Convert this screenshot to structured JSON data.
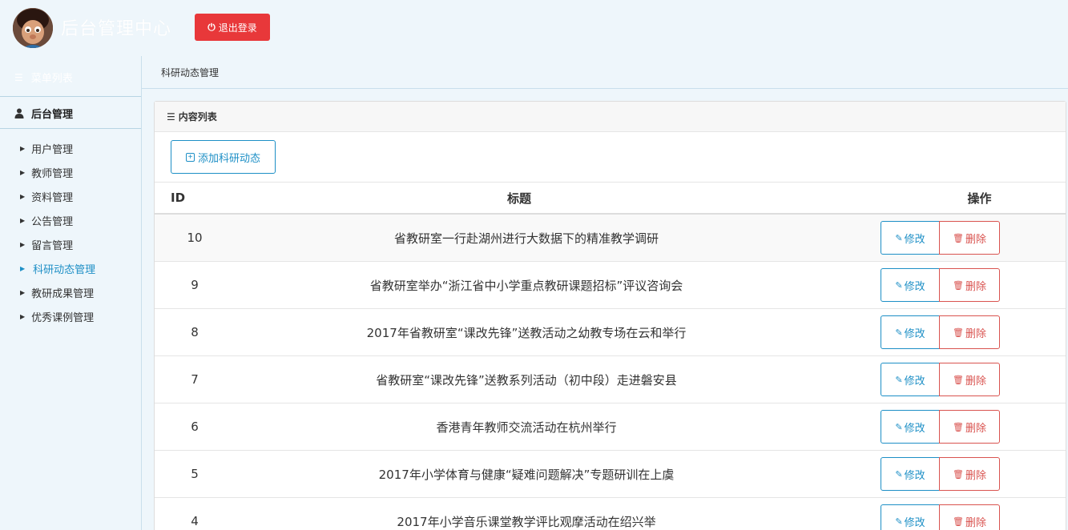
{
  "header": {
    "site_title": "后台管理中心",
    "logout_label": "退出登录"
  },
  "sidebar": {
    "menu_list_title": "菜单列表",
    "group_title": "后台管理",
    "items": [
      {
        "label": "用户管理",
        "active": false
      },
      {
        "label": "教师管理",
        "active": false
      },
      {
        "label": "资料管理",
        "active": false
      },
      {
        "label": "公告管理",
        "active": false
      },
      {
        "label": "留言管理",
        "active": false
      },
      {
        "label": "科研动态管理",
        "active": true
      },
      {
        "label": "教研成果管理",
        "active": false
      },
      {
        "label": "优秀课例管理",
        "active": false
      }
    ]
  },
  "breadcrumb": "科研动态管理",
  "panel": {
    "heading": "内容列表",
    "add_label": "添加科研动态"
  },
  "table": {
    "headers": {
      "id": "ID",
      "title": "标题",
      "ops": "操作"
    },
    "edit_label": "修改",
    "delete_label": "删除",
    "rows": [
      {
        "id": "10",
        "title": "省教研室一行赴湖州进行大数据下的精准教学调研"
      },
      {
        "id": "9",
        "title": "省教研室举办“浙江省中小学重点教研课题招标”评议咨询会"
      },
      {
        "id": "8",
        "title": "2017年省教研室“课改先锋”送教活动之幼教专场在云和举行"
      },
      {
        "id": "7",
        "title": "省教研室“课改先锋”送教系列活动（初中段）走进磐安县"
      },
      {
        "id": "6",
        "title": "香港青年教师交流活动在杭州举行"
      },
      {
        "id": "5",
        "title": "2017年小学体育与健康“疑难问题解决”专题研训在上虞"
      },
      {
        "id": "4",
        "title": "2017年小学音乐课堂教学评比观摩活动在绍兴举"
      }
    ]
  },
  "colors": {
    "accent": "#1d8fc6",
    "danger": "#e8383a",
    "background": "#eef6fb"
  }
}
